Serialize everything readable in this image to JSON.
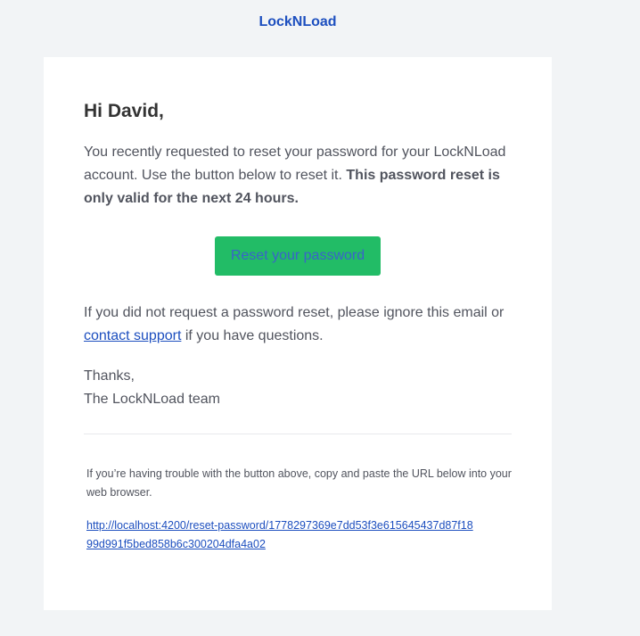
{
  "header": {
    "brand": "LockNLoad"
  },
  "email": {
    "greeting": "Hi David,",
    "intro_text": "You recently requested to reset your password for your LockNLoad account. Use the button below to reset it. ",
    "intro_bold": "This password reset is only valid for the next 24 hours.",
    "reset_button_label": "Reset your password",
    "ignore_text_before": "If you did not request a password reset, please ignore this email or ",
    "contact_link_label": "contact support",
    "ignore_text_after": " if you have questions.",
    "thanks": "Thanks,",
    "team_signature": "The LockNLoad team",
    "trouble_text": "If you’re having trouble with the button above, copy and paste the URL below into your web browser.",
    "reset_url": "http://localhost:4200/reset-password/1778297369e7dd53f3e615645437d87f1899d991f5bed858b6c300204dfa4a02"
  },
  "colors": {
    "background": "#f2f4f6",
    "card": "#ffffff",
    "brand": "#1d4fbf",
    "button_bg": "#22bc66",
    "text": "#51545e",
    "heading": "#333333"
  }
}
